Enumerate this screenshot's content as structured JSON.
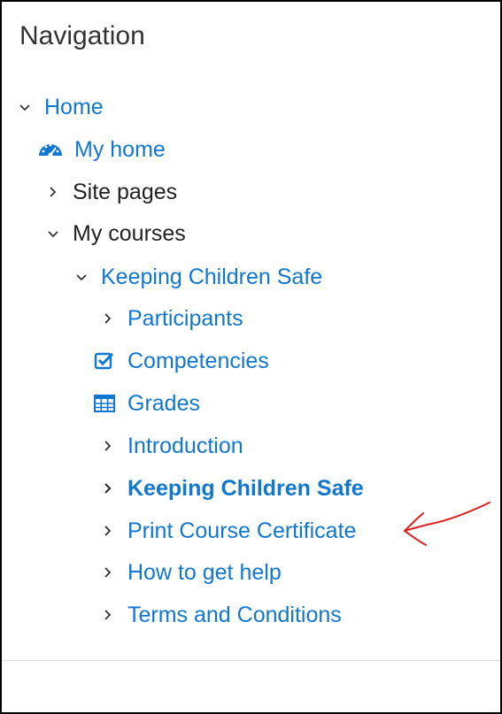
{
  "block": {
    "title": "Navigation"
  },
  "tree": {
    "home": "Home",
    "my_home": "My home",
    "site_pages": "Site pages",
    "my_courses": "My courses",
    "course": "Keeping Children Safe",
    "items": {
      "participants": "Participants",
      "competencies": "Competencies",
      "grades": "Grades",
      "introduction": "Introduction",
      "keeping_children_safe": "Keeping Children Safe",
      "print_certificate": "Print Course Certificate",
      "help": "How to get help",
      "terms": "Terms and Conditions"
    }
  },
  "colors": {
    "link": "#1177d1",
    "text": "#222222",
    "annotation_arrow": "#e02020"
  },
  "icons": {
    "expanded": "chevron-down-icon",
    "collapsed": "chevron-right-icon",
    "my_home": "dashboard-icon",
    "competencies": "checkbox-icon",
    "grades": "table-icon"
  }
}
